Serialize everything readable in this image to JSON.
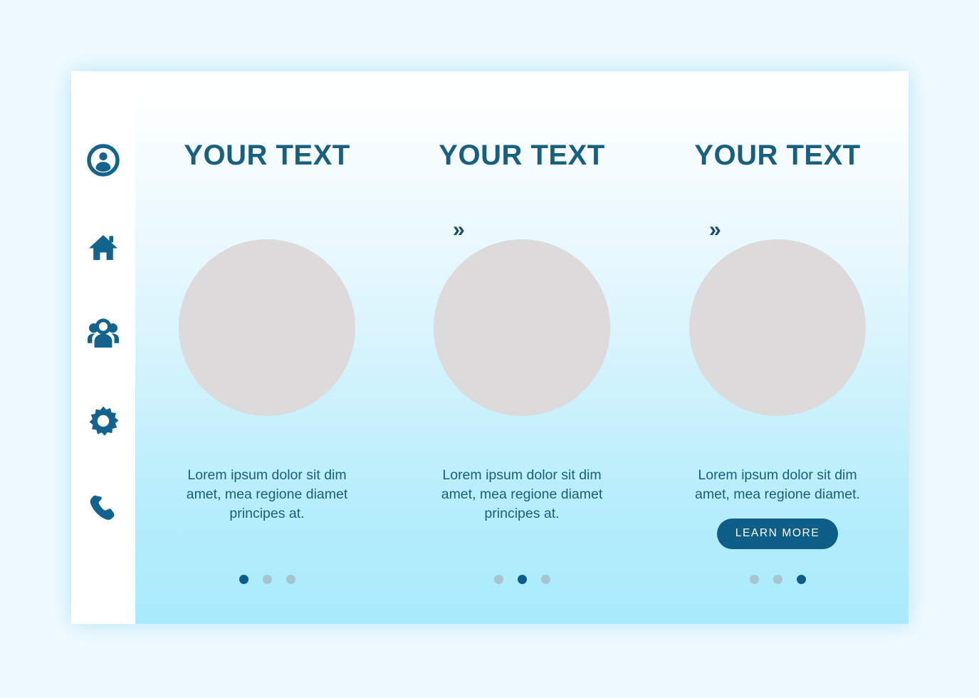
{
  "theme": {
    "page_background": "#eefaff",
    "panel_gradient_top": "#ffffff",
    "panel_gradient_bottom": "#a9ebfc",
    "accent_dark": "#0d5f8a",
    "heading_color": "#19607f",
    "body_text_color": "#1a5e7c",
    "sidebar_background": "#ffffff",
    "sidebar_icon_color": "#13638f",
    "image_placeholder_color": "#dcdada",
    "pager_inactive_color": "#a5c4cf",
    "pager_active_color": "#0c5d89"
  },
  "sidebar": {
    "items": [
      {
        "icon": "user-circle-icon",
        "label": "Account"
      },
      {
        "icon": "home-icon",
        "label": "Home"
      },
      {
        "icon": "users-group-icon",
        "label": "Team"
      },
      {
        "icon": "gear-icon",
        "label": "Settings"
      },
      {
        "icon": "phone-icon",
        "label": "Contact"
      }
    ]
  },
  "separators": {
    "chevron_glyph": "»",
    "items": [
      {
        "glyph": "»"
      },
      {
        "glyph": "»"
      }
    ]
  },
  "panels": [
    {
      "heading": "YOUR TEXT",
      "description": "Lorem ipsum dolor sit dim amet, mea regione diamet principes at.",
      "image_placeholder": "circle-image-placeholder",
      "button": null,
      "pager": {
        "total": 3,
        "active_index": 0
      }
    },
    {
      "heading": "YOUR TEXT",
      "description": "Lorem ipsum dolor sit dim amet, mea regione diamet principes at.",
      "image_placeholder": "circle-image-placeholder",
      "button": null,
      "pager": {
        "total": 3,
        "active_index": 1
      }
    },
    {
      "heading": "YOUR TEXT",
      "description": "Lorem ipsum dolor sit dim amet, mea regione diamet.",
      "image_placeholder": "circle-image-placeholder",
      "button": {
        "label": "LEARN MORE"
      },
      "pager": {
        "total": 3,
        "active_index": 2
      }
    }
  ]
}
